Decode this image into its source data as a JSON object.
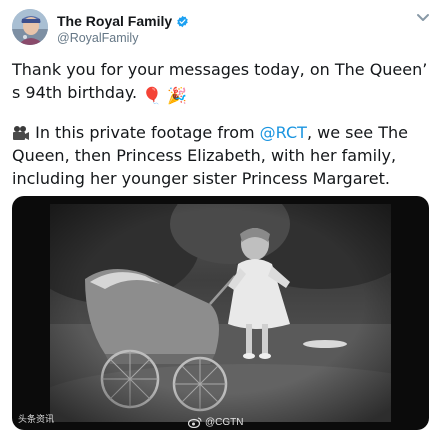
{
  "account": {
    "display_name": "The Royal Family",
    "handle": "@RoyalFamily",
    "avatar_icon": "profile-photo",
    "verified_icon": "verified-badge-icon",
    "verified_color": "#1da1f2"
  },
  "tweet": {
    "para1_text": "Thank you for your messages today, on The Queen’ s 94th birthday.",
    "para1_emojis": [
      "🎈",
      "🎉"
    ],
    "para2_lead": "In this private footage from ",
    "para2_mention": "@RCT",
    "para2_tail": ", we see The Queen, then Princess Elizabeth, with her family, including her younger sister Princess Margaret.",
    "para2_icon": "film-camera-icon",
    "mention_color": "#1b95e0"
  },
  "media": {
    "watermark_left": "头条资讯",
    "watermark_right": "@CGTN"
  }
}
